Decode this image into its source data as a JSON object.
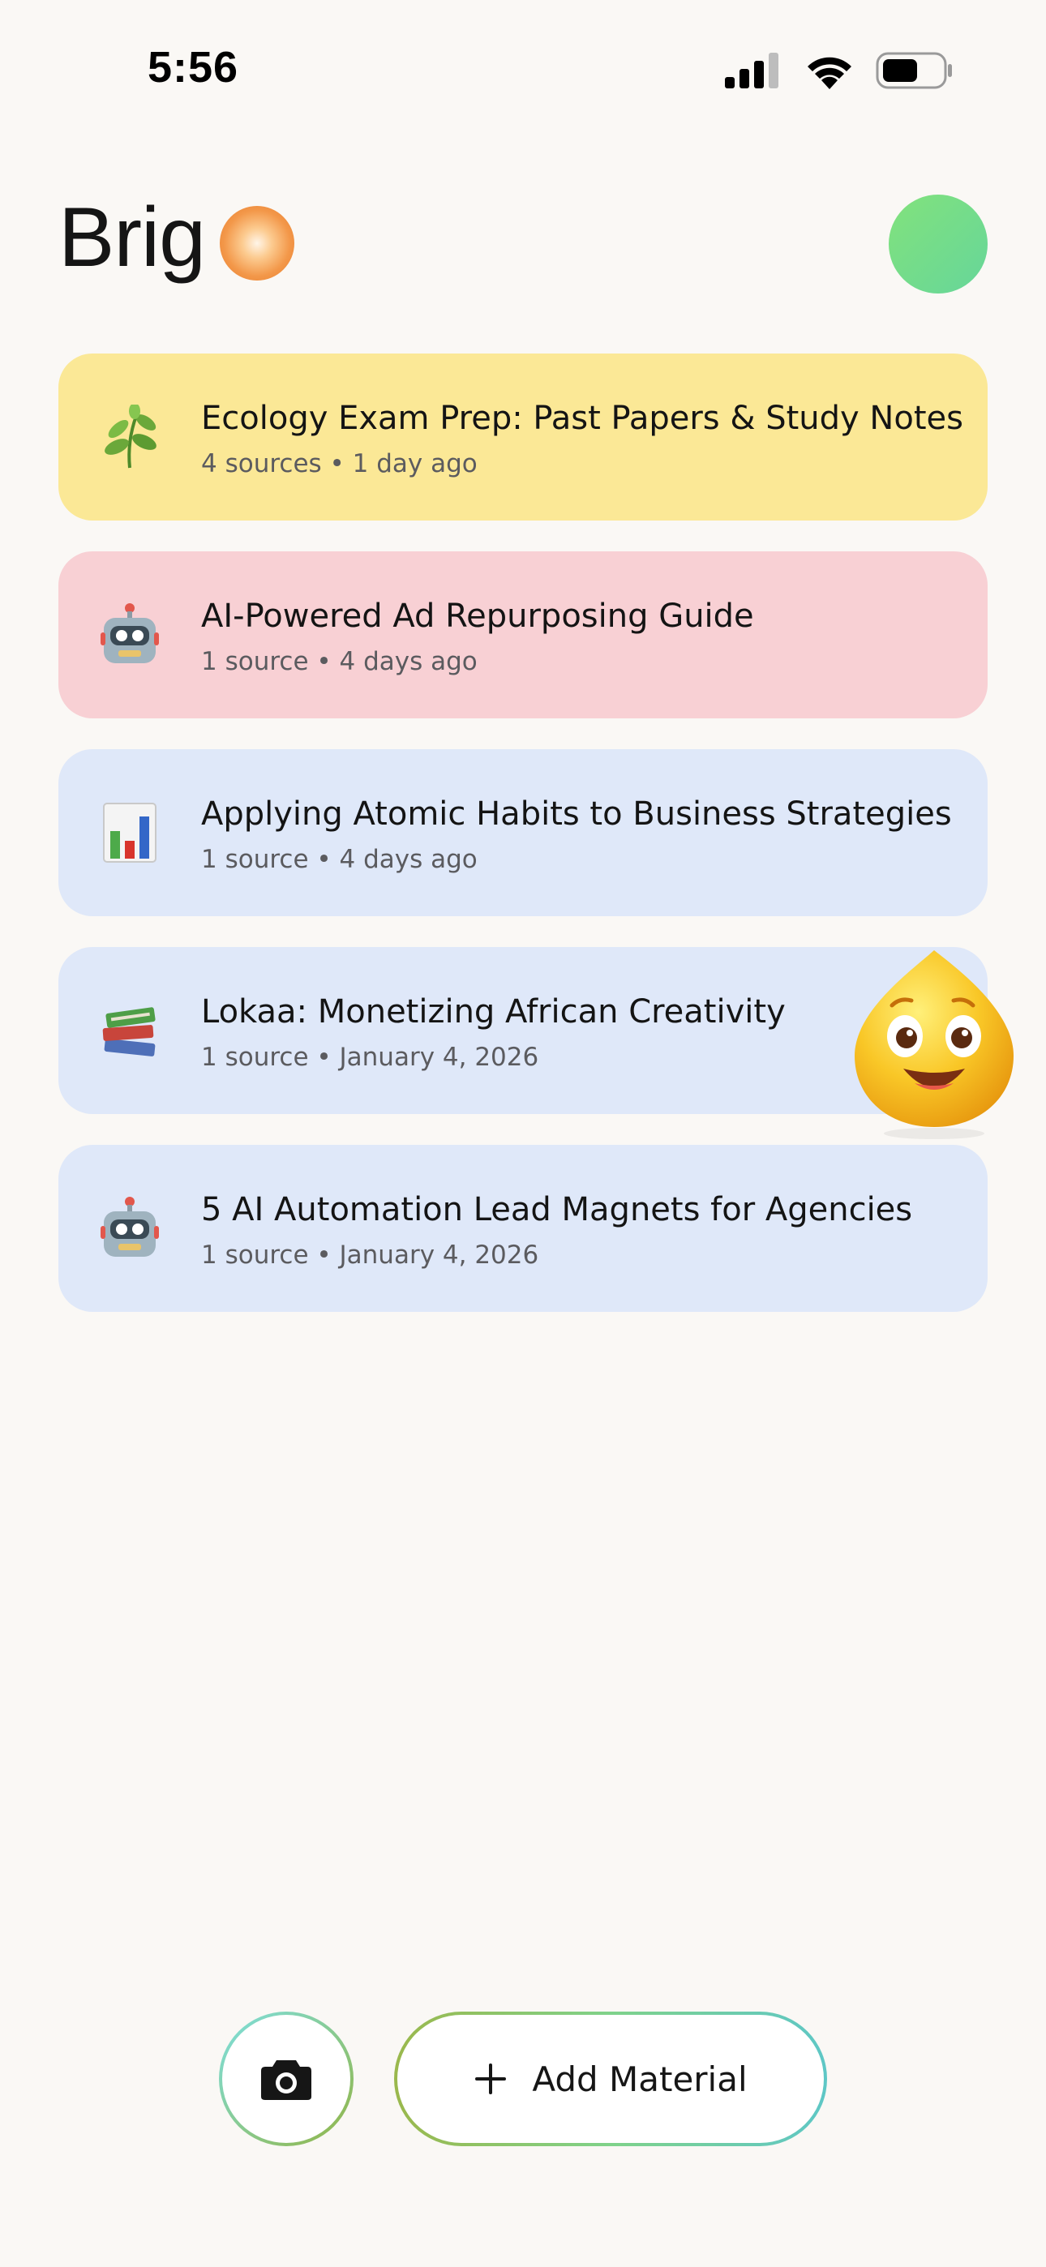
{
  "status_bar": {
    "time": "5:56",
    "icons": [
      "cellular-signal-icon",
      "wifi-icon",
      "battery-icon"
    ]
  },
  "header": {
    "brand": "Brig",
    "brand_orb": "orb-logo-icon",
    "avatar": "avatar"
  },
  "colors": {
    "yellow_card": "#FBE896",
    "pink_card": "#F8D0D4",
    "blue_card": "#DFE8F9",
    "avatar_green": "#74DD88",
    "brand_orange": "#F3984A"
  },
  "notebooks": [
    {
      "icon": "herb-leaf-icon",
      "title": "Ecology Exam Prep: Past Papers & Study Notes",
      "meta": "4 sources • 1 day ago",
      "color": "yellow"
    },
    {
      "icon": "robot-icon",
      "title": "AI-Powered Ad Repurposing Guide",
      "meta": "1 source • 4 days ago",
      "color": "pink"
    },
    {
      "icon": "bar-chart-icon",
      "title": "Applying Atomic Habits to Business Strategies",
      "meta": "1 source • 4 days ago",
      "color": "blue"
    },
    {
      "icon": "books-icon",
      "title": "Lokaa: Monetizing African Creativity",
      "meta": "1 source • January 4, 2026",
      "color": "blue"
    },
    {
      "icon": "robot-icon",
      "title": "5 AI Automation Lead Magnets for Agencies",
      "meta": "1 source • January 4, 2026",
      "color": "blue"
    }
  ],
  "mascot": "smiling-drop-mascot-icon",
  "actions": {
    "camera_icon": "camera-icon",
    "add_icon": "plus-icon",
    "add_label": "Add Material"
  }
}
